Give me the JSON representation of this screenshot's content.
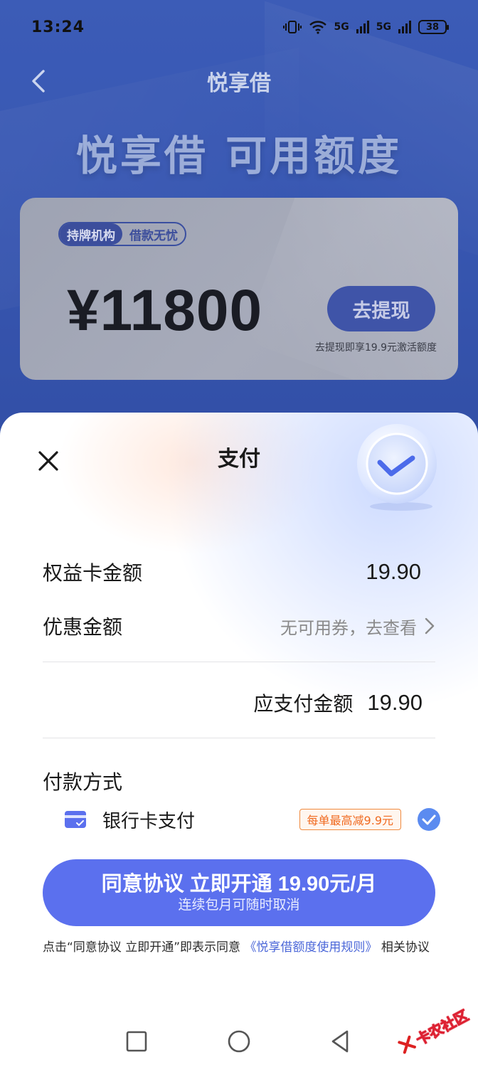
{
  "status_bar": {
    "time": "13:24",
    "network1": "5G",
    "network2": "5G",
    "battery": "38"
  },
  "nav": {
    "title": "悦享借"
  },
  "hero": {
    "title": "悦享借 可用额度"
  },
  "credit_card": {
    "tag_left": "持牌机构",
    "tag_right": "借款无忧",
    "amount": "¥11800",
    "withdraw_button": "去提现",
    "withdraw_note": "去提现即享19.9元激活额度"
  },
  "payment_sheet": {
    "title": "支付",
    "rows": [
      {
        "label": "权益卡金额",
        "value": "19.90"
      },
      {
        "label": "优惠金额",
        "value": "无可用券，去查看"
      }
    ],
    "payable_label": "应支付金额",
    "payable_value": "19.90",
    "method_title": "付款方式",
    "method": {
      "label": "银行卡支付",
      "promo": "每单最高减9.9元",
      "selected": true
    },
    "cta_main": "同意协议 立即开通 19.90元/月",
    "cta_sub": "连续包月可随时取消",
    "agreement_prefix": "点击“同意协议 立即开通”即表示同意",
    "agreement_link": "《悦享借额度使用规则》",
    "agreement_suffix": " 相关协议"
  },
  "watermark": {
    "text": "卡农社区"
  },
  "colors": {
    "accent": "#5b70ee",
    "promo": "#f06a20",
    "link": "#4a66d8",
    "hero_blue": "#2c53c2"
  }
}
